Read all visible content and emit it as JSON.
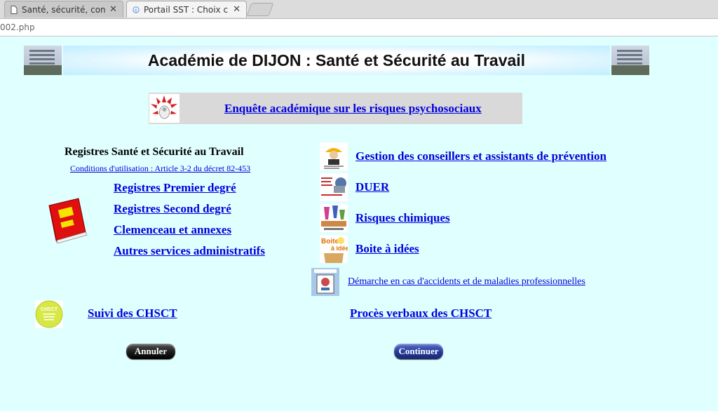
{
  "browser": {
    "tabs": [
      {
        "title": "Santé, sécurité, con",
        "active": false
      },
      {
        "title": "Portail SST : Choix c",
        "active": true
      }
    ],
    "url": "002.php"
  },
  "banner": {
    "title": "Académie de DIJON : Santé et Sécurité au Travail"
  },
  "survey": {
    "link": "Enquête académique sur les risques psychosociaux"
  },
  "registers": {
    "title": "Registres Santé et Sécurité au Travail",
    "conditions": "Conditions d'utilisation : Article 3-2 du décret 82-453",
    "links": [
      "Registres Premier degré",
      "Registres Second degré",
      "Clemenceau et annexes",
      "Autres services administratifs"
    ]
  },
  "right_links": [
    {
      "label": "Gestion des conseillers et assistants de prévention",
      "icon": "advisor-icon"
    },
    {
      "label": "DUER",
      "icon": "duer-document-icon"
    },
    {
      "label": "Risques chimiques",
      "icon": "chemical-risk-icon"
    },
    {
      "label": "Boite à idées",
      "icon": "idea-box-icon"
    },
    {
      "label": "Démarche en cas d'accidents et de maladies professionnelles",
      "icon": "accident-procedure-icon"
    }
  ],
  "chsct": {
    "suivi": "Suivi des CHSCT",
    "pv": "Procès verbaux des CHSCT"
  },
  "buttons": {
    "cancel": "Annuler",
    "continue": "Continuer"
  },
  "colors": {
    "page_bg": "#e0ffff",
    "link": "#0000dd",
    "survey_bg": "#d9d9d9"
  }
}
